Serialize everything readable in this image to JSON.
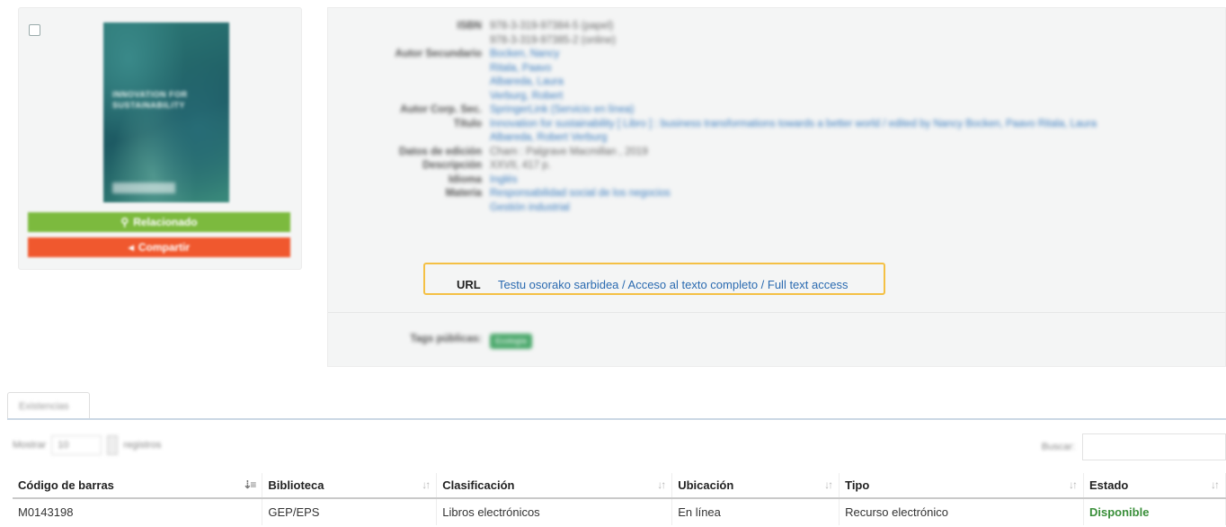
{
  "record": {
    "cover_title": "Innovation for Sustainability",
    "related_button": "Relacionado",
    "share_button": "Compartir",
    "fields": [
      {
        "label": "ISBN",
        "values": [
          "978-3-319-97384-5 (papel)",
          "978-3-319-97385-2 (online)"
        ],
        "style": "plain"
      },
      {
        "label": "Autor Secundario",
        "values": [
          "Bocken, Nancy",
          "Ritala, Paavo",
          "Albareda, Laura",
          "Verburg, Robert"
        ],
        "style": "link"
      },
      {
        "label": "Autor Corp. Sec.",
        "values": [
          "SpringerLink (Servicio en línea)"
        ],
        "style": "link"
      },
      {
        "label": "Título",
        "values": [
          "Innovation for sustainability [ Libro ] : business transformations towards a better world / edited by Nancy Bocken, Paavo Ritala, Laura",
          "Albareda, Robert Verburg"
        ],
        "style": "link"
      },
      {
        "label": "Datos de edición",
        "values": [
          "Cham : Palgrave Macmillan , 2019"
        ],
        "style": "plain"
      },
      {
        "label": "Descripción",
        "values": [
          "XXVII, 417 p."
        ],
        "style": "plain"
      },
      {
        "label": "Idioma",
        "values": [
          "Inglés"
        ],
        "style": "link"
      },
      {
        "label": "Materia",
        "values": [
          "Responsabilidad social de los negocios",
          "Gestión industrial"
        ],
        "style": "link"
      }
    ],
    "url_label": "URL",
    "url_text": "Testu osorako sarbidea / Acceso al texto completo / Full text access",
    "tags_label": "Tags públicas:",
    "tag": "Ecología"
  },
  "tabs": [
    {
      "label": "Existencias"
    }
  ],
  "table_controls": {
    "show_label": "Mostrar",
    "show_value": "10",
    "records_label": "registros",
    "search_label": "Buscar:"
  },
  "holdings": {
    "columns": [
      "Código de barras",
      "Biblioteca",
      "Clasificación",
      "Ubicación",
      "Tipo",
      "Estado"
    ],
    "rows": [
      [
        "M0143198",
        "GEP/EPS",
        "Libros electrónicos",
        "En línea",
        "Recurso electrónico",
        "Disponible"
      ]
    ]
  },
  "icons": {
    "related": "search-icon",
    "share": "share-icon",
    "sort": "sort-icon"
  },
  "colors": {
    "highlight": "#f4c044",
    "green_button": "#7cba3e",
    "orange_button": "#f0582e",
    "link": "#2a6ab0",
    "available": "#3a8f3a"
  }
}
